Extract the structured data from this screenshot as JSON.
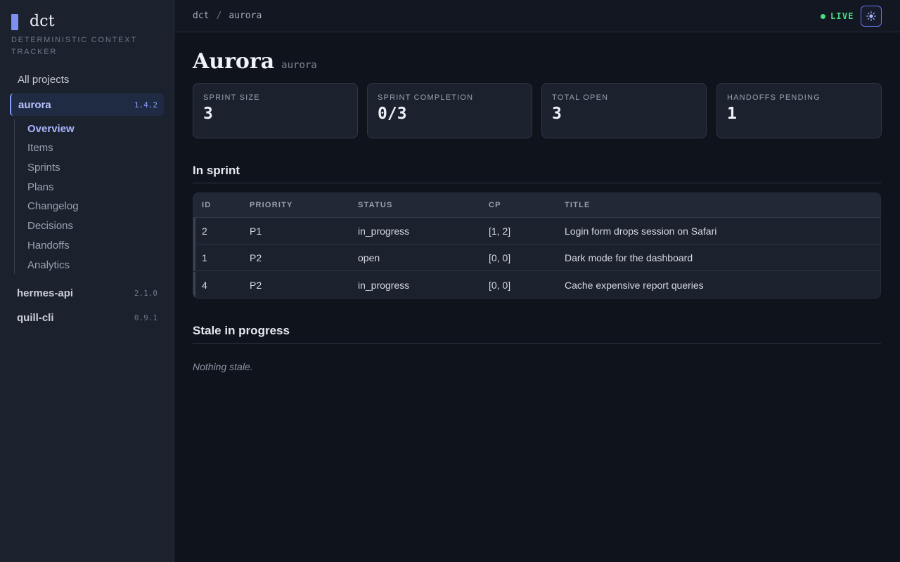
{
  "brand": {
    "name": "dct",
    "subtitle": "DETERMINISTIC CONTEXT TRACKER"
  },
  "sidebar": {
    "all_projects": "All projects",
    "projects": [
      {
        "name": "aurora",
        "version": "1.4.2",
        "active": true
      },
      {
        "name": "hermes-api",
        "version": "2.1.0",
        "active": false
      },
      {
        "name": "quill-cli",
        "version": "0.9.1",
        "active": false
      }
    ],
    "subnav": [
      "Overview",
      "Items",
      "Sprints",
      "Plans",
      "Changelog",
      "Decisions",
      "Handoffs",
      "Analytics"
    ],
    "subnav_active": "Overview"
  },
  "topbar": {
    "crumbs": [
      "dct",
      "aurora"
    ],
    "separator": "/",
    "live_label": "LIVE",
    "live_color": "#4ade80",
    "theme_icon": "sun-icon"
  },
  "page": {
    "title": "Aurora",
    "slug": "aurora"
  },
  "stats": [
    {
      "label": "SPRINT SIZE",
      "value": "3"
    },
    {
      "label": "SPRINT COMPLETION",
      "value": "0/3"
    },
    {
      "label": "TOTAL OPEN",
      "value": "3"
    },
    {
      "label": "HANDOFFS PENDING",
      "value": "1"
    }
  ],
  "in_sprint": {
    "heading": "In sprint",
    "columns": [
      "ID",
      "PRIORITY",
      "STATUS",
      "CP",
      "TITLE"
    ],
    "rows": [
      {
        "id": "2",
        "priority": "P1",
        "status": "in_progress",
        "cp": "[1, 2]",
        "title": "Login form drops session on Safari"
      },
      {
        "id": "1",
        "priority": "P2",
        "status": "open",
        "cp": "[0, 0]",
        "title": "Dark mode for the dashboard"
      },
      {
        "id": "4",
        "priority": "P2",
        "status": "in_progress",
        "cp": "[0, 0]",
        "title": "Cache expensive report queries"
      }
    ]
  },
  "stale": {
    "heading": "Stale in progress",
    "empty_text": "Nothing stale."
  },
  "colors": {
    "accent": "#8a9cff",
    "live": "#4ade80"
  }
}
